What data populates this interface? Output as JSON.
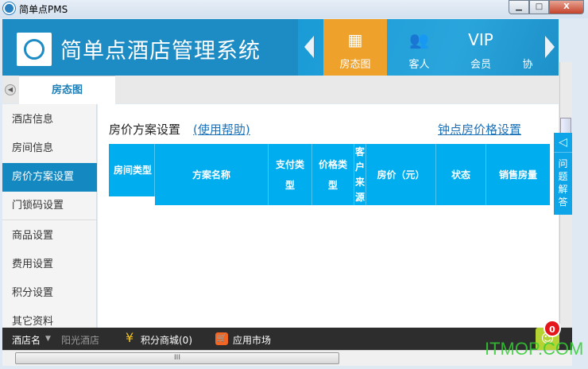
{
  "window": {
    "title": "简单点PMS",
    "min": "▁",
    "max": "□",
    "close": "X"
  },
  "header": {
    "app_name": "简单点酒店管理系统",
    "nav": [
      {
        "label": "房态图",
        "icon": "grid-icon"
      },
      {
        "label": "客人",
        "icon": "people-icon"
      },
      {
        "label": "会员",
        "icon": "vip-icon",
        "icon_text": "VIP"
      },
      {
        "label": "协",
        "icon": "more-icon"
      }
    ]
  },
  "tabs": {
    "active": "房态图"
  },
  "sidebar": {
    "items": [
      "酒店信息",
      "房间信息",
      "房价方案设置",
      "门锁码设置",
      "商品设置",
      "费用设置",
      "积分设置",
      "其它资料"
    ],
    "active_index": 2
  },
  "main": {
    "title": "房价方案设置",
    "help_link": "(使用帮助)",
    "clock_link": "钟点房价格设置",
    "columns": [
      "房间类型",
      "方案名称",
      "支付类型",
      "价格类型",
      "客户来源",
      "房价（元）",
      "状态",
      "销售房量"
    ]
  },
  "help_tab": {
    "label": "问题解答"
  },
  "bottom": {
    "hotel_label": "酒店名",
    "hotel_value": "阳光酒店",
    "points_mall": "积分商城(0)",
    "app_market": "应用市场",
    "chat_badge": "0",
    "watermark": "ITMOP.COM",
    "scroll_grip": "III"
  },
  "colors": {
    "header": "#1d8bc4",
    "accent": "#eea22c",
    "table_header": "#00aeef",
    "active": "#1488c0"
  }
}
